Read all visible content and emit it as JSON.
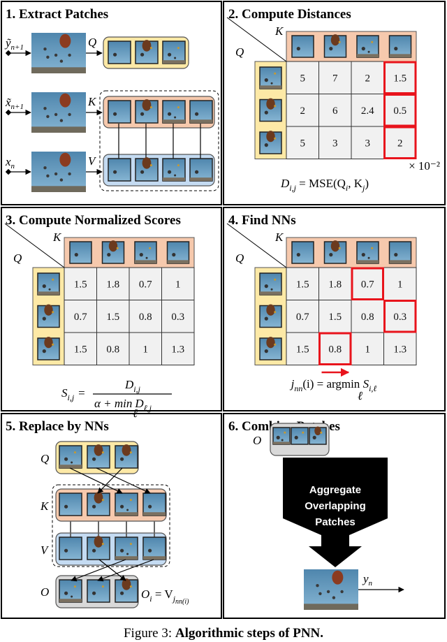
{
  "panels": {
    "p1": {
      "title": "1. Extract Patches",
      "inputs": [
        {
          "base": "ỹ",
          "sub": "n+1",
          "arrow_label": "Q"
        },
        {
          "base": "x̃",
          "sub": "n+1",
          "arrow_label": "K"
        },
        {
          "base": "x",
          "sub": "n",
          "arrow_label": "V"
        }
      ]
    },
    "p2": {
      "title": "2. Compute Distances",
      "row_label": "Q",
      "col_label": "K",
      "values": [
        [
          "5",
          "7",
          "2",
          "1.5"
        ],
        [
          "2",
          "6",
          "2.4",
          "0.5"
        ],
        [
          "5",
          "3",
          "3",
          "2"
        ]
      ],
      "scale_note": "× 10⁻²",
      "formula": [
        {
          "t": "D",
          "i": 1
        },
        {
          "t": "i,j",
          "s": 1
        },
        {
          "t": " = MSE(Q"
        },
        {
          "t": "i",
          "s": 1
        },
        {
          "t": ", K"
        },
        {
          "t": "j",
          "s": 1
        },
        {
          "t": ")"
        }
      ]
    },
    "p3": {
      "title": "3. Compute Normalized Scores",
      "row_label": "Q",
      "col_label": "K",
      "values": [
        [
          "1.5",
          "1.8",
          "0.7",
          "1"
        ],
        [
          "0.7",
          "1.5",
          "0.8",
          "0.3"
        ],
        [
          "1.5",
          "0.8",
          "1",
          "1.3"
        ]
      ],
      "formula": {
        "lhs": "S",
        "lhs_sub": "i,j",
        "eq": "=",
        "num": "D",
        "num_sub": "i,j",
        "den_a": "α + min",
        "den_min_sub": "ℓ",
        "den_d": "D",
        "den_d_sub": "ℓ,j"
      }
    },
    "p4": {
      "title": "4. Find NNs",
      "row_label": "Q",
      "col_label": "K",
      "values": [
        [
          "1.5",
          "1.8",
          "0.7",
          "1"
        ],
        [
          "0.7",
          "1.5",
          "0.8",
          "0.3"
        ],
        [
          "1.5",
          "0.8",
          "1",
          "1.3"
        ]
      ],
      "highlight_col_per_row": [
        2,
        3,
        1
      ],
      "formula": [
        {
          "t": "j",
          "i": 1
        },
        {
          "t": "nn",
          "s": 1
        },
        {
          "t": "(i) = argmin "
        },
        {
          "t": "S",
          "i": 1
        },
        {
          "t": "i,ℓ",
          "s": 1
        }
      ],
      "argmin_sub": "ℓ"
    },
    "p5": {
      "title": "5. Replace by NNs",
      "labels": {
        "q": "Q",
        "k": "K",
        "v": "V",
        "o": "O"
      },
      "formula": [
        {
          "t": "O",
          "i": 1
        },
        {
          "t": "i",
          "s": 1
        },
        {
          "t": " = V"
        },
        {
          "t": "j",
          "s": 1
        },
        {
          "t": "nn(i)",
          "s": 2
        }
      ]
    },
    "p6": {
      "title": "6. Combine Patches",
      "o_label": "O",
      "aggregate_lines": [
        "Aggregate",
        "Overlapping",
        "Patches"
      ],
      "output_base": "y",
      "output_sub": "n"
    }
  },
  "colors": {
    "query": "#fde9a6",
    "key": "#f6c9ad",
    "value": "#c4dbf2",
    "output": "#d9d9d9",
    "highlight": "#e8141c",
    "cell": "#f1f1f1"
  },
  "caption": {
    "prefix": "Figure 3: ",
    "bold": "Algorithmic steps of PNN."
  }
}
